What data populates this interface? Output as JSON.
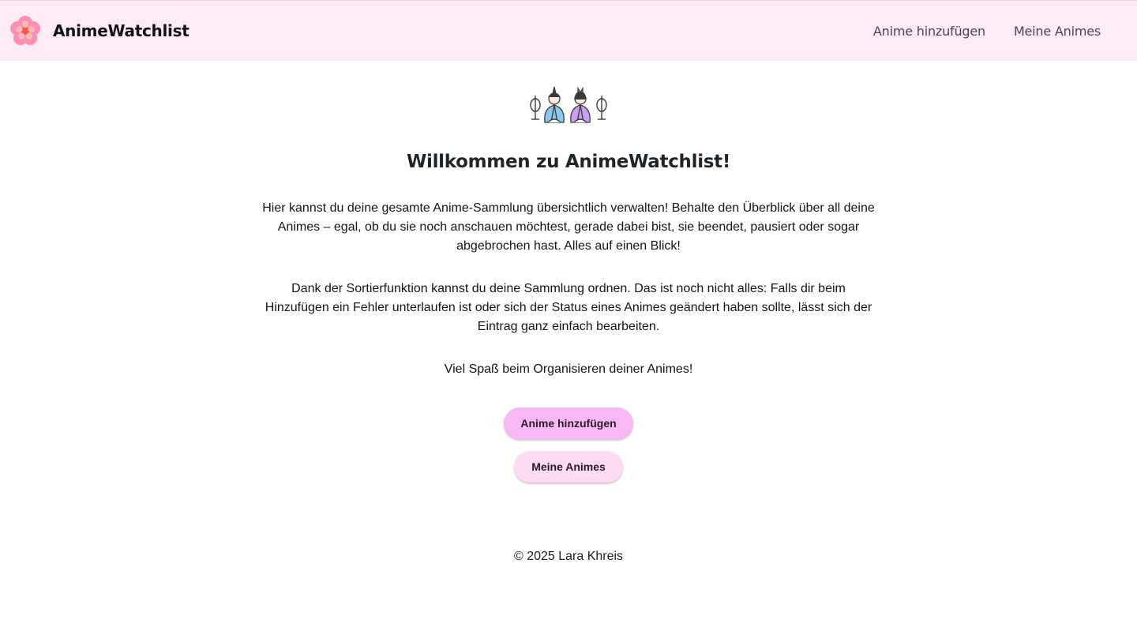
{
  "header": {
    "brand_name": "AnimeWatchlist",
    "logo_icon": "cherry-blossom-icon",
    "nav": [
      {
        "label": "Anime hinzufügen"
      },
      {
        "label": "Meine Animes"
      }
    ]
  },
  "main": {
    "illustration_icon": "hina-dolls-icon",
    "title": "Willkommen zu AnimeWatchlist!",
    "paragraphs": [
      "Hier kannst du deine gesamte Anime-Sammlung übersichtlich verwalten! Behalte den Überblick über all deine Animes – egal, ob du sie noch anschauen möchtest, gerade dabei bist, sie beendet, pausiert oder sogar abgebrochen hast. Alles auf einen Blick!",
      "Dank der Sortierfunktion kannst du deine Sammlung ordnen. Das ist noch nicht alles: Falls dir beim Hinzufügen ein Fehler unterlaufen ist oder sich der Status eines Animes geändert haben sollte, lässt sich der Eintrag ganz einfach bearbeiten.",
      "Viel Spaß beim Organisieren deiner Animes!"
    ],
    "buttons": {
      "primary_label": "Anime hinzufügen",
      "secondary_label": "Meine Animes"
    }
  },
  "footer": {
    "copyright": "© 2025 Lara Khreis"
  },
  "colors": {
    "navbar_bg": "#fdebf8",
    "primary_button": "#f9b8f5",
    "secondary_button": "#fcdcf4"
  }
}
